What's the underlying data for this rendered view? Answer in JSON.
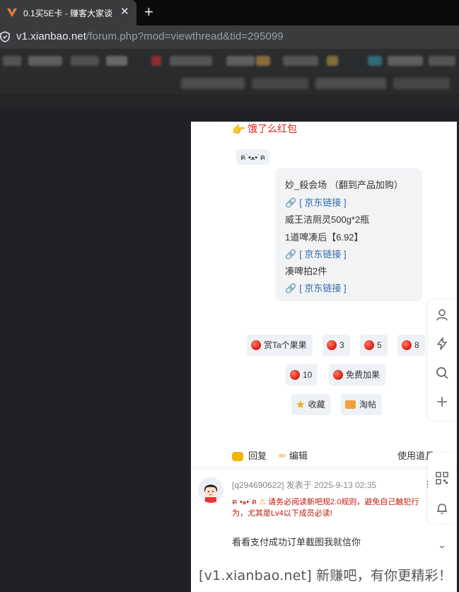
{
  "browser": {
    "tab_title": "0.1买5E卡 - 赚客大家谈",
    "tab_close": "✕",
    "new_tab": "+",
    "url_domain": "v1.xianbao.net",
    "url_path": "/forum.php?mod=viewthread&tid=295099"
  },
  "post": {
    "red_packet_link": "饿了么红包",
    "kaomoji": "ฅ˙•ﻌ•˙ฅ",
    "quote": {
      "line1": "妙_殺会场 （翻到产品加购）",
      "link_label": "[ 京东链接 ]",
      "line2": "威王洁厕灵500g*2瓶",
      "line3": "1道啤凑后【6.92】",
      "line4": "凑啤拍2件"
    },
    "buttons": {
      "reward": "赏Ta个果果",
      "apple3": "3",
      "apple5": "5",
      "apple8": "8",
      "apple10": "10",
      "free_add": "免费加果",
      "favorite": "收藏",
      "tao_post": "淘帖"
    },
    "actions": {
      "reply": "回复",
      "edit": "编辑",
      "tools": "使用道具"
    }
  },
  "reply_post": {
    "user": "[q294690622]",
    "meta": " 发表于 2025-9-13 02:35",
    "top_mark": "扌",
    "notice_kaomoji": "ฅ˙•ﻌ•˙ฅ",
    "notice": "请务必阅读新吧规2.0规则，避免自己触犯行为，尤其是Lv4以下成员必读!",
    "body": "看看支付成功订单截图我就信你"
  },
  "watermark": "[v1.xianbao.net] 新赚吧，有你更精彩！",
  "colors": {
    "link": "#2f6aa8",
    "red": "#e2231a",
    "notice": "#c0180c"
  }
}
